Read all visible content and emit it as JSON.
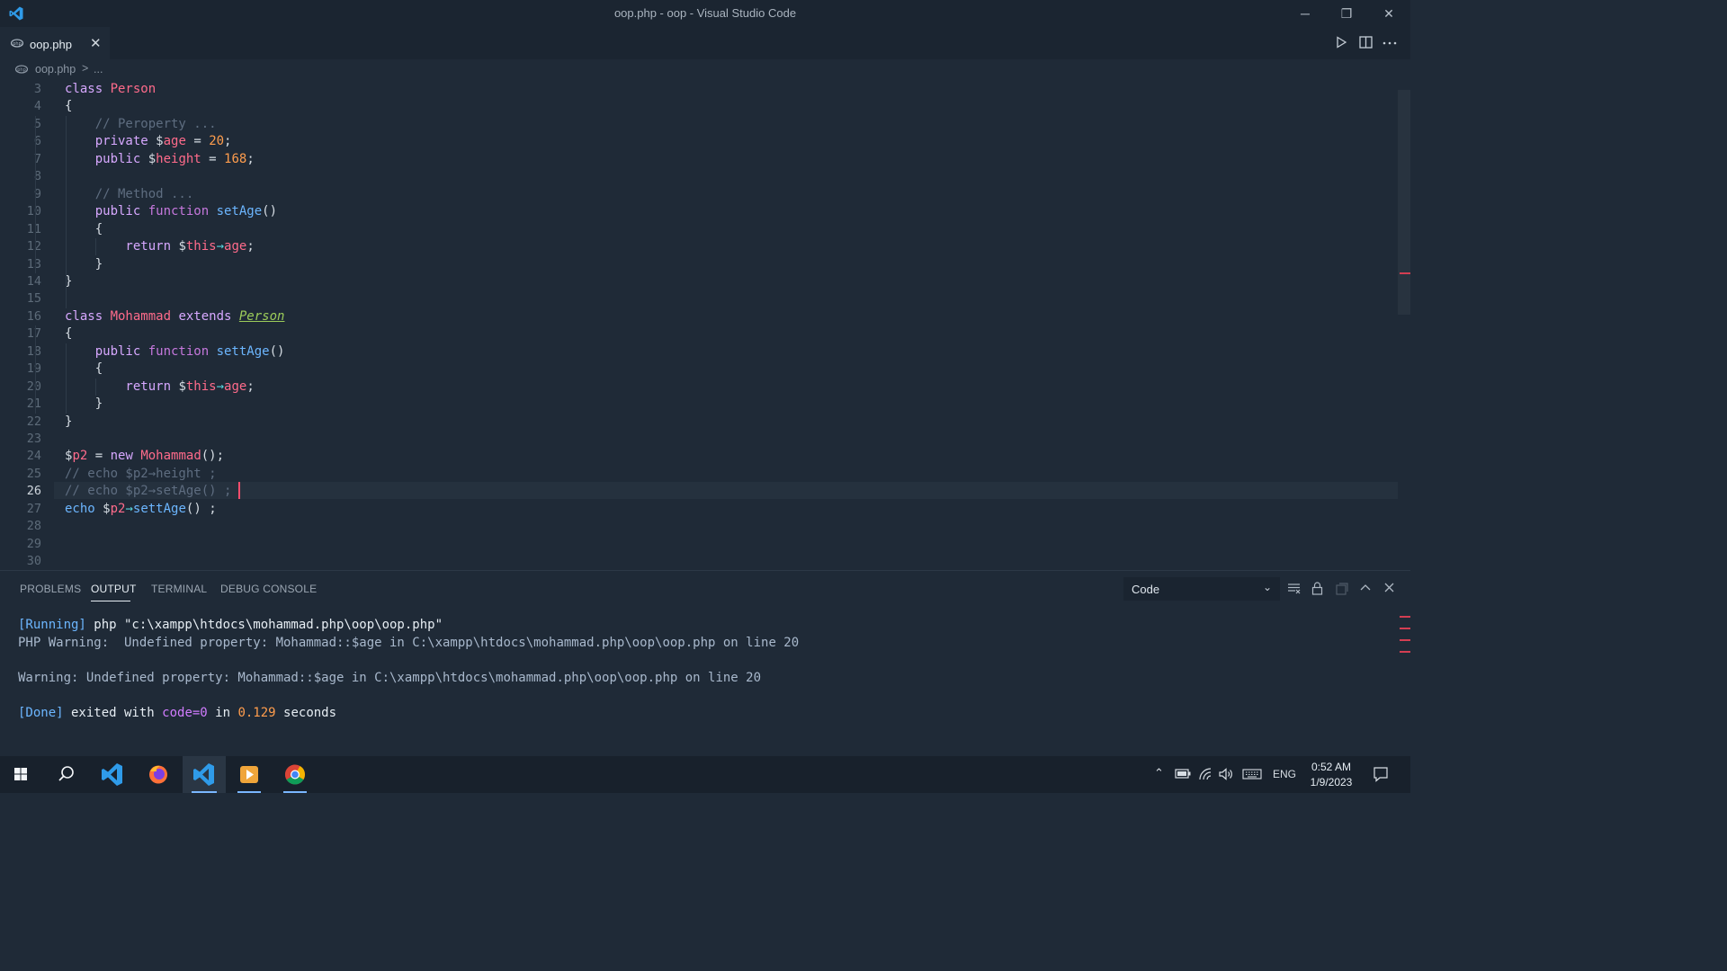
{
  "window": {
    "title": "oop.php - oop - Visual Studio Code",
    "minimize": "─",
    "restore": "❐",
    "close": "✕"
  },
  "tabs": [
    {
      "label": "oop.php",
      "close": "✕"
    }
  ],
  "breadcrumb": {
    "file": "oop.php",
    "separator": ">",
    "more": "..."
  },
  "editor": {
    "current_line": 26,
    "lines": [
      {
        "n": "3",
        "code": [
          {
            "t": "class ",
            "c": "kw"
          },
          {
            "t": "Person",
            "c": "cls"
          }
        ]
      },
      {
        "n": "4",
        "code": [
          {
            "t": "{",
            "c": ""
          }
        ]
      },
      {
        "n": "5",
        "code": [
          {
            "t": "    // Peroperty ...",
            "c": "cm"
          }
        ]
      },
      {
        "n": "6",
        "code": [
          {
            "t": "    private ",
            "c": "kw"
          },
          {
            "t": "$",
            "c": ""
          },
          {
            "t": "age",
            "c": "var"
          },
          {
            "t": " = ",
            "c": ""
          },
          {
            "t": "20",
            "c": "num"
          },
          {
            "t": ";",
            "c": ""
          }
        ]
      },
      {
        "n": "7",
        "code": [
          {
            "t": "    public ",
            "c": "kw"
          },
          {
            "t": "$",
            "c": ""
          },
          {
            "t": "height",
            "c": "var"
          },
          {
            "t": " = ",
            "c": ""
          },
          {
            "t": "168",
            "c": "num"
          },
          {
            "t": ";",
            "c": ""
          }
        ]
      },
      {
        "n": "8",
        "code": [
          {
            "t": "",
            "c": ""
          }
        ]
      },
      {
        "n": "9",
        "code": [
          {
            "t": "    // Method ...",
            "c": "cm"
          }
        ]
      },
      {
        "n": "10",
        "code": [
          {
            "t": "    public ",
            "c": "kw"
          },
          {
            "t": "function ",
            "c": "k"
          },
          {
            "t": "setAge",
            "c": "fn"
          },
          {
            "t": "()",
            "c": ""
          }
        ]
      },
      {
        "n": "11",
        "code": [
          {
            "t": "    {",
            "c": ""
          }
        ]
      },
      {
        "n": "12",
        "code": [
          {
            "t": "        return ",
            "c": "kw"
          },
          {
            "t": "$",
            "c": ""
          },
          {
            "t": "this",
            "c": "var"
          },
          {
            "t": "→",
            "c": "op"
          },
          {
            "t": "age",
            "c": "var"
          },
          {
            "t": ";",
            "c": ""
          }
        ]
      },
      {
        "n": "13",
        "code": [
          {
            "t": "    }",
            "c": ""
          }
        ]
      },
      {
        "n": "14",
        "code": [
          {
            "t": "}",
            "c": ""
          }
        ]
      },
      {
        "n": "15",
        "code": [
          {
            "t": "",
            "c": ""
          }
        ]
      },
      {
        "n": "16",
        "code": [
          {
            "t": "class ",
            "c": "kw"
          },
          {
            "t": "Mohammad",
            "c": "cls"
          },
          {
            "t": " extends ",
            "c": "kw"
          },
          {
            "t": "Person",
            "c": "inh"
          }
        ]
      },
      {
        "n": "17",
        "code": [
          {
            "t": "{",
            "c": ""
          }
        ]
      },
      {
        "n": "18",
        "code": [
          {
            "t": "    public ",
            "c": "kw"
          },
          {
            "t": "function ",
            "c": "k"
          },
          {
            "t": "settAge",
            "c": "fn"
          },
          {
            "t": "()",
            "c": ""
          }
        ]
      },
      {
        "n": "19",
        "code": [
          {
            "t": "    {",
            "c": ""
          }
        ]
      },
      {
        "n": "20",
        "code": [
          {
            "t": "        return ",
            "c": "kw"
          },
          {
            "t": "$",
            "c": ""
          },
          {
            "t": "this",
            "c": "var"
          },
          {
            "t": "→",
            "c": "op"
          },
          {
            "t": "age",
            "c": "var"
          },
          {
            "t": ";",
            "c": ""
          }
        ]
      },
      {
        "n": "21",
        "code": [
          {
            "t": "    }",
            "c": ""
          }
        ]
      },
      {
        "n": "22",
        "code": [
          {
            "t": "}",
            "c": ""
          }
        ]
      },
      {
        "n": "23",
        "code": [
          {
            "t": "",
            "c": ""
          }
        ]
      },
      {
        "n": "24",
        "code": [
          {
            "t": "$",
            "c": ""
          },
          {
            "t": "p2",
            "c": "var"
          },
          {
            "t": " = ",
            "c": ""
          },
          {
            "t": "new ",
            "c": "kw"
          },
          {
            "t": "Mohammad",
            "c": "cls"
          },
          {
            "t": "();",
            "c": ""
          }
        ]
      },
      {
        "n": "25",
        "code": [
          {
            "t": "// echo $p2→height ;",
            "c": "cm"
          }
        ]
      },
      {
        "n": "26",
        "code": [
          {
            "t": "// echo $p2→setAge() ;",
            "c": "cm"
          }
        ]
      },
      {
        "n": "27",
        "code": [
          {
            "t": "echo ",
            "c": "fn"
          },
          {
            "t": "$",
            "c": ""
          },
          {
            "t": "p2",
            "c": "var"
          },
          {
            "t": "→",
            "c": "op"
          },
          {
            "t": "settAge",
            "c": "fn"
          },
          {
            "t": "() ;",
            "c": ""
          }
        ]
      },
      {
        "n": "28",
        "code": [
          {
            "t": "",
            "c": ""
          }
        ]
      },
      {
        "n": "29",
        "code": [
          {
            "t": "",
            "c": ""
          }
        ]
      },
      {
        "n": "30",
        "code": [
          {
            "t": "",
            "c": ""
          }
        ]
      }
    ]
  },
  "panel": {
    "tabs": [
      "PROBLEMS",
      "OUTPUT",
      "TERMINAL",
      "DEBUG CONSOLE"
    ],
    "active_tab": "OUTPUT",
    "channel": "Code",
    "output": [
      [
        {
          "t": "[Running]",
          "c": "o-run"
        },
        {
          "t": " php \"c:\\xampp\\htdocs\\mohammad.php\\oop\\oop.php\"",
          "c": "o-white"
        }
      ],
      [
        {
          "t": "PHP Warning:  Undefined property: Mohammad::$age in C:\\xampp\\htdocs\\mohammad.php\\oop\\oop.php on line 20",
          "c": "o-warn"
        }
      ],
      [
        {
          "t": "",
          "c": ""
        }
      ],
      [
        {
          "t": "Warning: Undefined property: Mohammad::$age in C:\\xampp\\htdocs\\mohammad.php\\oop\\oop.php on line 20",
          "c": "o-warn"
        }
      ],
      [
        {
          "t": "",
          "c": ""
        }
      ],
      [
        {
          "t": "[Done]",
          "c": "o-run"
        },
        {
          "t": " exited with ",
          "c": "o-white"
        },
        {
          "t": "code=0",
          "c": "o-code"
        },
        {
          "t": " in ",
          "c": "o-white"
        },
        {
          "t": "0.129",
          "c": "o-num"
        },
        {
          "t": " seconds",
          "c": "o-white"
        }
      ]
    ]
  },
  "taskbar": {
    "apps": [
      "start",
      "search",
      "vscode",
      "firefox",
      "vscode-active",
      "media-player",
      "chrome"
    ],
    "language": "ENG",
    "time": "0:52 AM",
    "date": "1/9/2023"
  }
}
